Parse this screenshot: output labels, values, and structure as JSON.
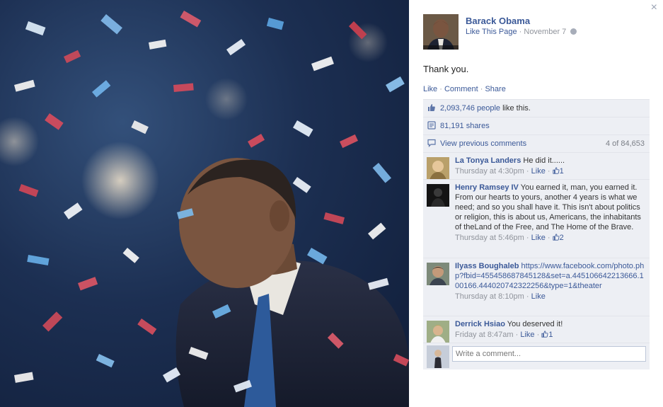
{
  "post": {
    "author": "Barack Obama",
    "like_page_label": "Like This Page",
    "date": "November 7",
    "text": "Thank you."
  },
  "actions": {
    "like": "Like",
    "comment": "Comment",
    "share": "Share"
  },
  "likes_line": "2,093,746 people",
  "likes_suffix": "like this.",
  "shares_line": "81,191 shares",
  "previous_comments": {
    "label": "View previous comments",
    "count": "4 of 84,653"
  },
  "comments": [
    {
      "author": "La Tonya Landers",
      "text": "He did it......",
      "time": "Thursday at 4:30pm",
      "like_label": "Like",
      "likes": "1"
    },
    {
      "author": "Henry Ramsey IV",
      "text": "You earned it, man, you earned it. From our hearts to yours, another 4 years is what we need; and so you shall have it. This isn't about politics or religion, this is about us, Americans, the inhabitants of theLand of the Free, and The Home of the Brave.",
      "time": "Thursday at 5:46pm",
      "like_label": "Like",
      "likes": "2"
    },
    {
      "author": "Ilyass Boughaleb",
      "link": "https://www.facebook.com/photo.php?fbid=455458687845128&set=a.445106642213666.100166.444020742322256&type=1&theater",
      "time": "Thursday at 8:10pm",
      "like_label": "Like"
    },
    {
      "author": "Derrick Hsiao",
      "text": "You deserved it!",
      "time": "Friday at 8:47am",
      "like_label": "Like",
      "likes": "1"
    }
  ],
  "write_comment": {
    "placeholder": "Write a comment..."
  },
  "close_glyph": "×",
  "separator": "·"
}
